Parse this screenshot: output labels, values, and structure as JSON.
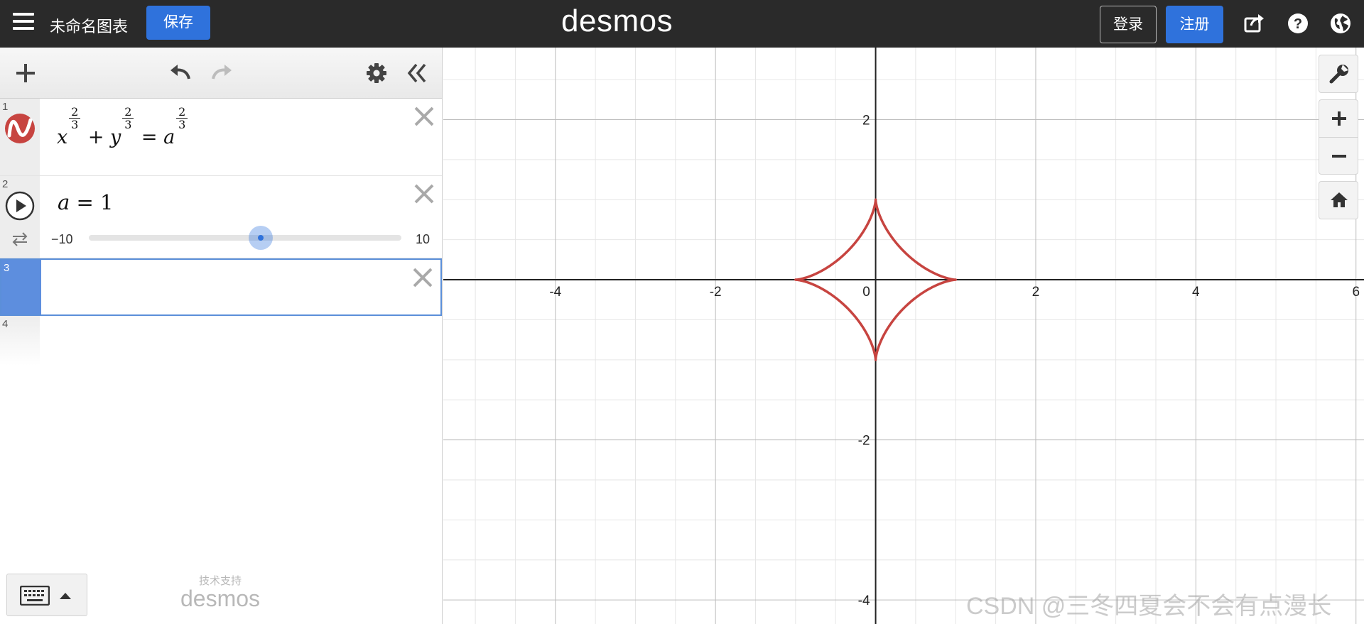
{
  "header": {
    "graph_title": "未命名图表",
    "save_label": "保存",
    "logo_text": "desmos",
    "login_label": "登录",
    "signup_label": "注册",
    "icons": [
      "menu-icon",
      "share-icon",
      "help-icon",
      "language-globe-icon"
    ]
  },
  "toolbar": {
    "icons": [
      "add-icon",
      "undo-icon",
      "redo-icon",
      "settings-gear-icon",
      "collapse-panel-icon"
    ]
  },
  "expressions": [
    {
      "index": "1",
      "icon": "graph-color-icon",
      "color": "#c74440",
      "latex": "x^{2/3} + y^{2/3} = a^{2/3}",
      "parts": {
        "x": "x",
        "y": "y",
        "a": "a",
        "plus": "+",
        "eq": "=",
        "num": "2",
        "den": "3"
      }
    },
    {
      "index": "2",
      "icon": "play-icon",
      "secondary_icon": "loop-icon",
      "var": "a",
      "eq": "=",
      "value": "1",
      "slider": {
        "min_label": "−10",
        "max_label": "10",
        "min": -10,
        "max": 10,
        "value": 1
      }
    },
    {
      "index": "3",
      "active": true
    },
    {
      "index": "4"
    }
  ],
  "footer": {
    "powered_small": "技术支持",
    "powered_logo": "desmos",
    "icons": [
      "keyboard-icon",
      "caret-up-icon"
    ]
  },
  "graph": {
    "x_ticks": [
      "-4",
      "-2",
      "0",
      "2",
      "4",
      "6"
    ],
    "y_ticks": [
      "2",
      "-2",
      "-4"
    ],
    "x_range": [
      -5.4,
      6.1
    ],
    "y_range": [
      -4.3,
      2.9
    ],
    "curve": {
      "type": "astroid",
      "a": 1,
      "color": "#c74440"
    },
    "controls": [
      "wrench-icon",
      "zoom-in-icon",
      "zoom-out-icon",
      "home-icon"
    ]
  },
  "watermark": "CSDN @三冬四夏会不会有点漫长"
}
